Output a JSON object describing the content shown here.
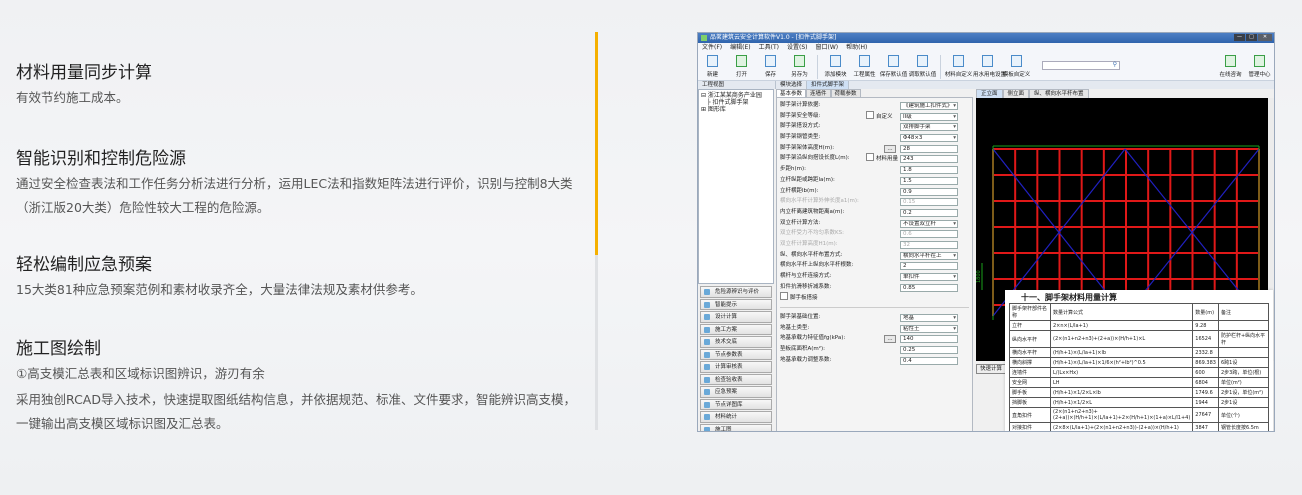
{
  "features": [
    {
      "title": "材料用量同步计算",
      "lines": [
        "有效节约施工成本。"
      ]
    },
    {
      "title": "智能识别和控制危险源",
      "lines": [
        "通过安全检查表法和工作任务分析法进行分析，运用LEC法和指数矩阵法进行评价，识别与控制8大类（浙江版20大类）危险性较大工程的危险源。"
      ]
    },
    {
      "title": "轻松编制应急预案",
      "lines": [
        "15大类81种应急预案范例和素材收录齐全，大量法律法规及素材供参考。"
      ]
    },
    {
      "title": "施工图绘制",
      "lines": [
        "①高支模汇总表和区域标识图辨识，游刃有余",
        "采用独创RCAD导入技术，快速提取图纸结构信息，并依据规范、标准、文件要求，智能辨识高支模，一键输出高支模区域标识图及汇总表。"
      ]
    }
  ],
  "app": {
    "title": "品茗建筑云安全计算软件V1.0 - [扣件式脚手架]",
    "window_buttons": [
      "—",
      "□",
      "✕"
    ],
    "menu": [
      "文件(F)",
      "编辑(E)",
      "工具(T)",
      "设置(S)",
      "窗口(W)",
      "帮助(H)"
    ],
    "toolbar": [
      "新建",
      "打开",
      "保存",
      "另存为",
      "|",
      "添加模块",
      "工程属性",
      "保存默认值",
      "调取默认值",
      "|",
      "材料自定义",
      "用水用电设置",
      "模板自定义"
    ],
    "toolbar_right": [
      "在线咨询",
      "管理中心"
    ],
    "search_placeholder": "",
    "panel_tabs": [
      "工程视图",
      "模块选择",
      "扣件式脚手架"
    ],
    "tree": [
      "⊟ 浙江某某商务产业园",
      "　├ 扣件式脚手架",
      "⊞ 图形库"
    ],
    "side_buttons": [
      "危险源辨识与评价",
      "智能提示",
      "设计计算",
      "施工方案",
      "技术交底",
      "节点参数表",
      "计算审核表",
      "检查验收表",
      "应急预案",
      "节点详图库",
      "材料统计",
      "施工图"
    ],
    "form_tabs": [
      "基本参数",
      "连墙件",
      "荷载参数"
    ],
    "form_fields": [
      {
        "label": "脚手架计算依据:",
        "value": "《建筑施工扣件式》",
        "type": "sel"
      },
      {
        "label": "脚手架安全等级:",
        "value": "II级",
        "type": "sel",
        "check": "自定义"
      },
      {
        "label": "脚手架搭设方式:",
        "value": "双排脚手架",
        "type": "sel"
      },
      {
        "label": "脚手架钢管类型:",
        "value": "Φ48×3",
        "type": "sel"
      },
      {
        "label": "脚手架架体高度H(m):",
        "value": "28",
        "type": "txt",
        "dots": "..."
      },
      {
        "label": "脚手架沿纵向搭设长度L(m):",
        "value": "243",
        "type": "txt",
        "check": "材料用量"
      },
      {
        "label": "步距h(m):",
        "value": "1.8",
        "type": "txt"
      },
      {
        "label": "立杆纵距或跨距la(m):",
        "value": "1.5",
        "type": "txt"
      },
      {
        "label": "立杆横距lb(m):",
        "value": "0.9",
        "type": "txt"
      },
      {
        "label": "横向水平杆计算外伸长度a1(m):",
        "value": "0.15",
        "type": "txt",
        "dis": true
      },
      {
        "label": "内立杆离建筑物距离a(m):",
        "value": "0.2",
        "type": "txt"
      },
      {
        "label": "双立杆计算方法:",
        "value": "不设置双立杆",
        "type": "sel"
      },
      {
        "label": "双立杆受力不均匀系数KS:",
        "value": "0.6",
        "type": "txt",
        "dis": true
      },
      {
        "label": "双立杆计算高度H1(m):",
        "value": "32",
        "type": "txt",
        "dis": true
      },
      {
        "label": "纵、横向水平杆布置方式:",
        "value": "横向水平杆在上",
        "type": "sel"
      },
      {
        "label": "横向水平杆上纵向水平杆根数:",
        "value": "2",
        "type": "txt"
      },
      {
        "label": "横杆与立杆连接方式:",
        "value": "单扣件",
        "type": "sel"
      },
      {
        "label": "扣件抗滑移折减系数:",
        "value": "0.85",
        "type": "txt"
      },
      {
        "label": "",
        "check": "脚手板搭接",
        "type": "none"
      }
    ],
    "form_fields2": [
      {
        "label": "脚手架基础位置:",
        "value": "地基",
        "type": "sel"
      },
      {
        "label": "地基土类型:",
        "value": "粘性土",
        "type": "sel"
      },
      {
        "label": "地基承载力特征值fg(kPa):",
        "value": "140",
        "type": "txt",
        "dots": "..."
      },
      {
        "label": "垫板底面积A(m²):",
        "value": "0.25",
        "type": "txt"
      },
      {
        "label": "地基承载力调整系数:",
        "value": "0.4",
        "type": "txt"
      }
    ],
    "view_tabs": [
      "正立面",
      "侧立面",
      "纵、横向水平杆布置"
    ],
    "dimension_label": "1800",
    "calc_button": "快速计算",
    "doc": {
      "title": "十一、脚手架材料用量计算",
      "headers": [
        "脚手架杆部件名称",
        "数量计算公式",
        "数量(m)",
        "备注"
      ],
      "rows": [
        [
          "立杆",
          "2×n×(L/la+1)",
          "9.28",
          ""
        ],
        [
          "纵向水平杆",
          "(2×(n1+n2+n3)+(2+a))×(H/h+1)×L",
          "16524",
          "防护栏杆+纵向水平杆"
        ],
        [
          "横向水平杆",
          "(H/h+1)×(L/la+1)×lb",
          "2332.8",
          ""
        ],
        [
          "横向斜撑",
          "(H/h+1)×(L/la+1)×1/6×(h²+lb²)^0.5",
          "869.383",
          "6跨1设"
        ],
        [
          "连墙件",
          "L/(Lx×Hx)",
          "600",
          "2步3跨，单位(根)"
        ],
        [
          "安全网",
          "LH",
          "6804",
          "单位(m²)"
        ],
        [
          "脚手板",
          "(H/h+1)×1/2×L×lb",
          "1749.6",
          "2步1设，单位(m²)"
        ],
        [
          "挡脚板",
          "(H/h+1)×1/2×L",
          "1944",
          "2步1设"
        ],
        [
          "直角扣件",
          "(2×(n1+n2+n3)+(2+a))×(H/h+1)×(L/la+1)+2×(H/h+1)×(1+a)×L/l1+4)",
          "27647",
          "单位(个)"
        ],
        [
          "对接扣件",
          "(2×8×(L/la+1)+(2×(n1+n2+n3))-(2+a))×(H/h+1)",
          "3847",
          "钢管长度按6.5m"
        ]
      ]
    }
  }
}
